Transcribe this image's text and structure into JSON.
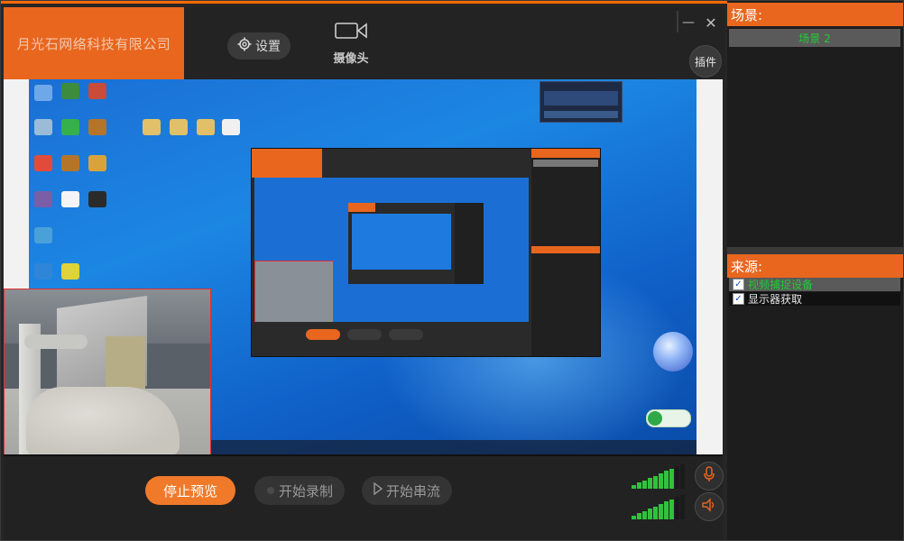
{
  "app": {
    "brand": "月光石网络科技有限公司",
    "settings_label": "设置",
    "camera_label": "摄像头",
    "plugin_label": "插件",
    "minimize_glyph": "—",
    "close_glyph": "✕"
  },
  "controls": {
    "stop_preview_label": "停止预览",
    "start_record_label": "开始录制",
    "start_stream_label": "开始串流",
    "mic_meter_level": 0.75,
    "speaker_meter_level": 0.8
  },
  "scenes": {
    "header": "场景:",
    "items": [
      {
        "label": "场景 2",
        "selected": true
      }
    ]
  },
  "sources": {
    "header": "来源:",
    "items": [
      {
        "label": "视频捕捉设备",
        "checked": true,
        "selected": true
      },
      {
        "label": "显示器获取",
        "checked": true,
        "selected": false
      }
    ]
  },
  "colors": {
    "accent": "#e9661e",
    "active_text": "#22cc33",
    "meter": "#31c23d",
    "camera_inset_border": "#e23030"
  },
  "icons": {
    "settings": "gear-icon",
    "camera": "video-camera-icon",
    "microphone": "microphone-icon",
    "speaker": "speaker-icon",
    "record": "record-dot-icon",
    "stream": "play-triangle-icon",
    "checkbox": "checkbox-checked-icon"
  }
}
